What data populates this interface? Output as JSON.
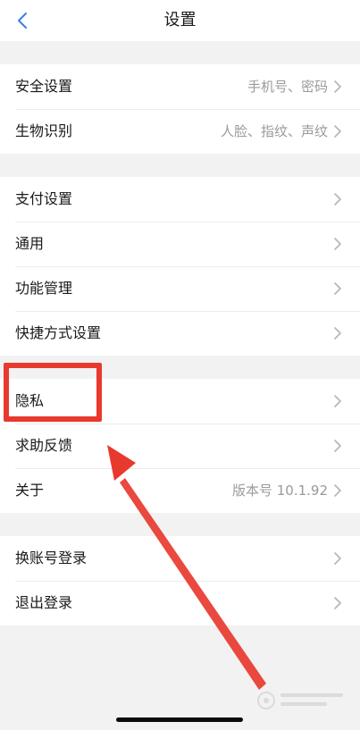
{
  "nav": {
    "title": "设置"
  },
  "groups": [
    {
      "items": [
        {
          "label": "安全设置",
          "detail": "手机号、密码"
        },
        {
          "label": "生物识别",
          "detail": "人脸、指纹、声纹"
        }
      ]
    },
    {
      "items": [
        {
          "label": "支付设置",
          "detail": ""
        },
        {
          "label": "通用",
          "detail": ""
        },
        {
          "label": "功能管理",
          "detail": ""
        },
        {
          "label": "快捷方式设置",
          "detail": ""
        }
      ]
    },
    {
      "items": [
        {
          "label": "隐私",
          "detail": ""
        },
        {
          "label": "求助反馈",
          "detail": ""
        },
        {
          "label": "关于",
          "detail": "版本号 10.1.92"
        }
      ]
    },
    {
      "items": [
        {
          "label": "换账号登录",
          "detail": ""
        },
        {
          "label": "退出登录",
          "detail": ""
        }
      ]
    }
  ],
  "colors": {
    "accent_blue": "#3d7fe0",
    "annotation_red": "#e8392f"
  },
  "icons": {
    "back": "chevron-left-icon",
    "row": "chevron-right-icon"
  }
}
